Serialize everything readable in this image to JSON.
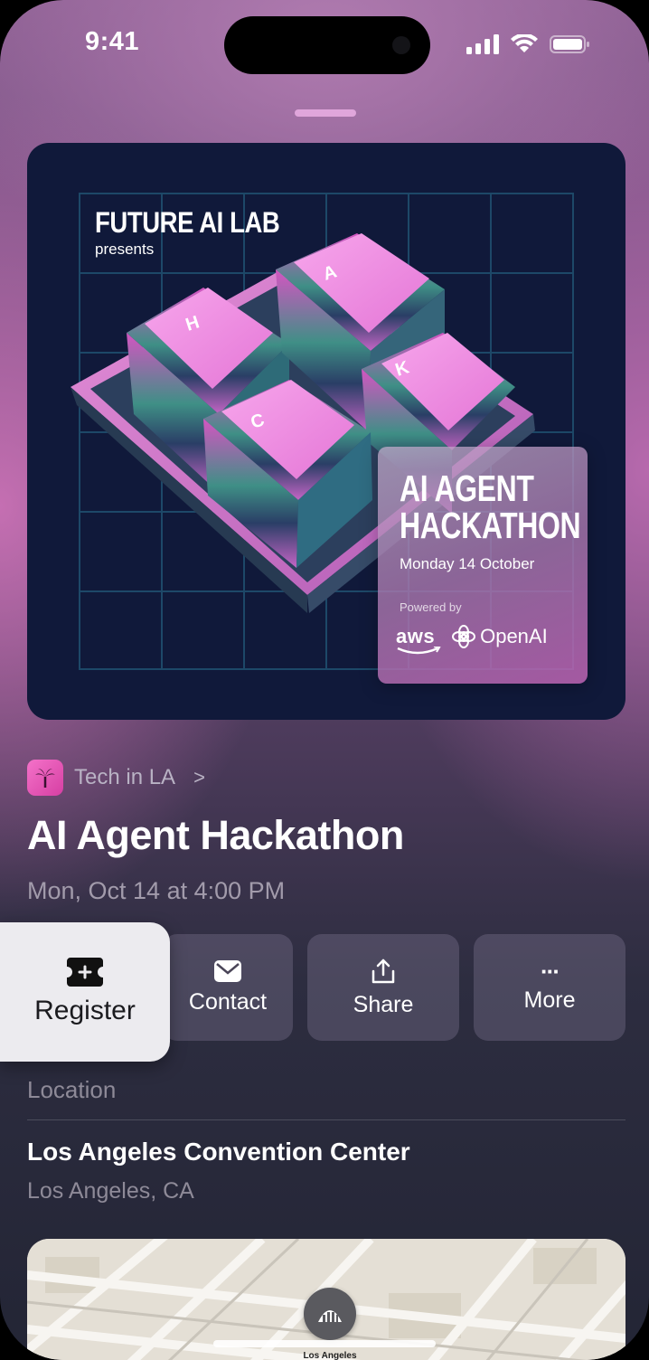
{
  "status_bar": {
    "time": "9:41",
    "icons": [
      "cellular-signal-icon",
      "wifi-icon",
      "battery-icon"
    ]
  },
  "poster": {
    "brand": "FUTURE AI LAB",
    "presents": "presents",
    "keys": [
      "H",
      "A",
      "C",
      "K"
    ],
    "title_line1": "AI AGENT",
    "title_line2": "HACKATHON",
    "date": "Monday 14 October",
    "powered_by": "Powered by",
    "sponsors": [
      "aws",
      "OpenAI"
    ],
    "colors": {
      "background": "#10193a",
      "keys": "#f08ae0",
      "grid": "#1f4a6a"
    }
  },
  "organizer": {
    "name": "Tech in LA",
    "icon": "palm-tree-icon",
    "chevron": ">"
  },
  "event": {
    "title": "AI Agent Hackathon",
    "datetime": "Mon, Oct 14 at 4:00 PM"
  },
  "actions": {
    "register": {
      "label": "Register",
      "icon": "ticket-plus-icon"
    },
    "contact": {
      "label": "Contact",
      "icon": "envelope-icon"
    },
    "share": {
      "label": "Share",
      "icon": "share-icon"
    },
    "more": {
      "label": "More",
      "icon": "ellipsis-icon",
      "glyph": "···"
    }
  },
  "location": {
    "header": "Location",
    "name": "Los Angeles Convention Center",
    "city": "Los Angeles, CA",
    "map_pin_label": "Los Angeles"
  }
}
